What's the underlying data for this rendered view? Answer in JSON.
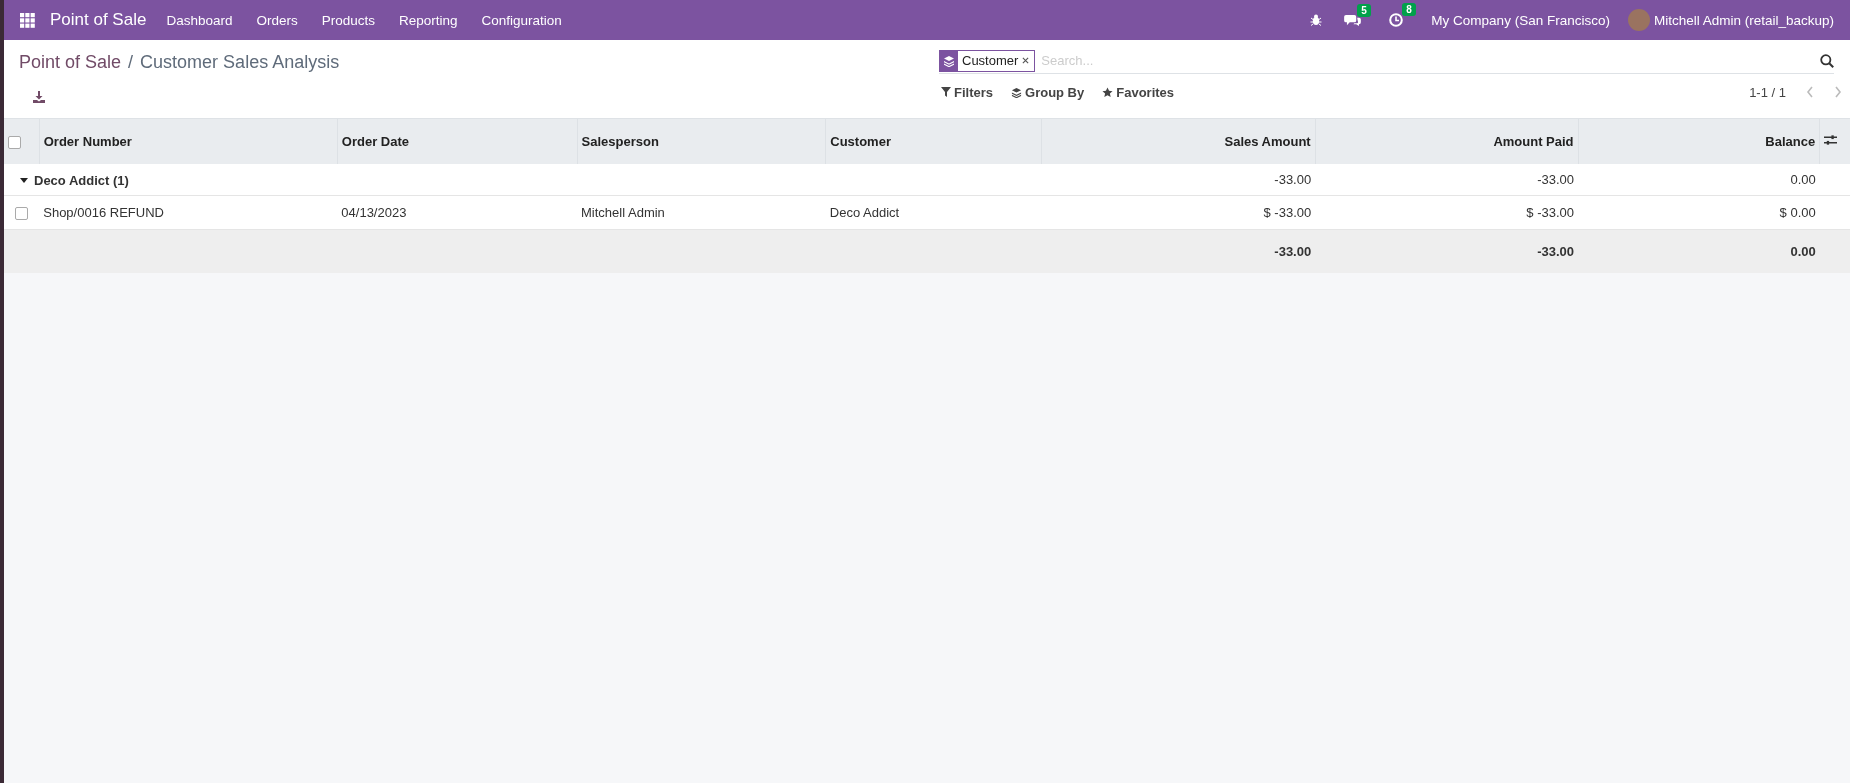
{
  "navbar": {
    "app_name": "Point of Sale",
    "menu": [
      "Dashboard",
      "Orders",
      "Products",
      "Reporting",
      "Configuration"
    ],
    "messages_count": "5",
    "activities_count": "8",
    "company": "My Company (San Francisco)",
    "user": "Mitchell Admin (retail_backup)"
  },
  "breadcrumb": {
    "parent": "Point of Sale",
    "separator": "/",
    "current": "Customer Sales Analysis"
  },
  "search": {
    "facet": "Customer",
    "placeholder": "Search..."
  },
  "search_options": [
    "Filters",
    "Group By",
    "Favorites"
  ],
  "pager": "1-1 / 1",
  "table": {
    "columns": [
      "Order Number",
      "Order Date",
      "Salesperson",
      "Customer",
      "Sales Amount",
      "Amount Paid",
      "Balance"
    ],
    "header_checked": false,
    "groups": [
      {
        "label": "Deco Addict (1)",
        "expanded": true,
        "totals": {
          "sales_amount": "-33.00",
          "amount_paid": "-33.00",
          "balance": "0.00"
        },
        "rows": [
          {
            "checked": false,
            "cells": [
              "Shop/0016 REFUND",
              "04/13/2023",
              "Mitchell Admin",
              "Deco Addict",
              "$ -33.00",
              "$ -33.00",
              "$ 0.00"
            ]
          }
        ]
      }
    ],
    "footer": {
      "sales_amount": "-33.00",
      "amount_paid": "-33.00",
      "balance": "0.00"
    }
  }
}
